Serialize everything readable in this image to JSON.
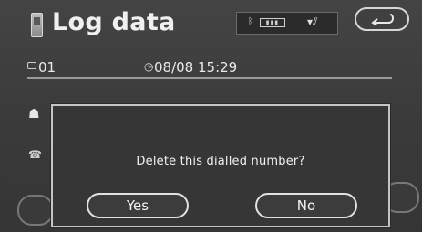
{
  "header": {
    "title": "Log data",
    "title_icon": "phone-icon",
    "status": {
      "bluetooth_icon": "bluetooth-icon",
      "battery_icon": "battery-icon",
      "signal_icon": "signal-icon"
    },
    "back_icon": "back-arrow-icon"
  },
  "record": {
    "number": "01",
    "datetime": "08/08 15:29",
    "record_icon": "record-icon",
    "clock_icon": "clock-icon"
  },
  "dialog": {
    "message": "Delete this dialled number?",
    "yes_label": "Yes",
    "no_label": "No"
  },
  "colors": {
    "background": "#3c3c3c",
    "text": "#f2f2f2",
    "border": "#c4c4c4"
  }
}
